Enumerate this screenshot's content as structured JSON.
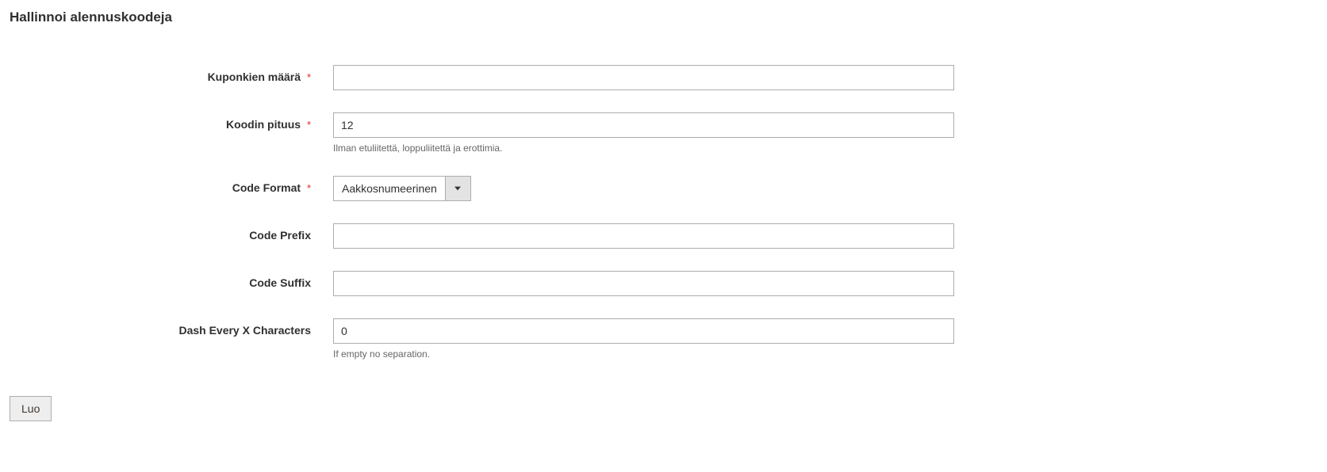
{
  "section": {
    "title": "Hallinnoi alennuskoodeja"
  },
  "fields": {
    "coupon_qty": {
      "label": "Kuponkien määrä",
      "required": true,
      "value": ""
    },
    "code_length": {
      "label": "Koodin pituus",
      "required": true,
      "value": "12",
      "note": "Ilman etuliitettä, loppuliitettä ja erottimia."
    },
    "code_format": {
      "label": "Code Format",
      "required": true,
      "value": "Aakkosnumeerinen"
    },
    "code_prefix": {
      "label": "Code Prefix",
      "required": false,
      "value": ""
    },
    "code_suffix": {
      "label": "Code Suffix",
      "required": false,
      "value": ""
    },
    "dash_every": {
      "label": "Dash Every X Characters",
      "required": false,
      "value": "0",
      "note": "If empty no separation."
    }
  },
  "buttons": {
    "generate": "Luo"
  },
  "required_mark": "*"
}
